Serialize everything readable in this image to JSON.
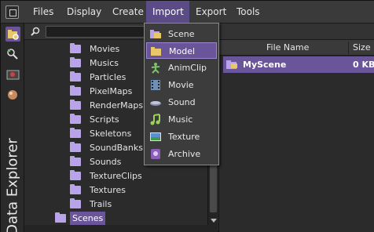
{
  "menubar": {
    "items": [
      "Files",
      "Display",
      "Create",
      "Import",
      "Export",
      "Tools"
    ],
    "active": "Import"
  },
  "sidebar": {
    "vertical_tab": "Data Explorer",
    "tool_icons": [
      "data-explorer-icon",
      "scene-explorer-icon",
      "render-icon",
      "material-icon"
    ]
  },
  "tree": {
    "items": [
      {
        "label": "Movies",
        "level": 2
      },
      {
        "label": "Musics",
        "level": 2
      },
      {
        "label": "Particles",
        "level": 2
      },
      {
        "label": "PixelMaps",
        "level": 2
      },
      {
        "label": "RenderMaps",
        "level": 2
      },
      {
        "label": "Scripts",
        "level": 2
      },
      {
        "label": "Skeletons",
        "level": 2
      },
      {
        "label": "SoundBanks",
        "level": 2
      },
      {
        "label": "Sounds",
        "level": 2
      },
      {
        "label": "TextureClips",
        "level": 2
      },
      {
        "label": "Textures",
        "level": 2
      },
      {
        "label": "Trails",
        "level": 2
      },
      {
        "label": "Scenes",
        "level": 1,
        "selected": true
      }
    ]
  },
  "filelist": {
    "columns": [
      "File Name",
      "Size"
    ],
    "rows": [
      {
        "name": "MyScene",
        "size": "0 KB"
      }
    ]
  },
  "import_menu": {
    "items": [
      {
        "label": "Scene",
        "icon": "scene-icon"
      },
      {
        "label": "Model",
        "icon": "model-icon",
        "highlighted": true
      },
      {
        "label": "AnimClip",
        "icon": "animclip-icon"
      },
      {
        "label": "Movie",
        "icon": "movie-icon"
      },
      {
        "label": "Sound",
        "icon": "sound-icon"
      },
      {
        "label": "Music",
        "icon": "music-icon"
      },
      {
        "label": "Texture",
        "icon": "texture-icon"
      },
      {
        "label": "Archive",
        "icon": "archive-icon"
      }
    ]
  },
  "colors": {
    "accent": "#6a559a",
    "folder": "#b9a3ea",
    "background": "#2b2b2b"
  }
}
